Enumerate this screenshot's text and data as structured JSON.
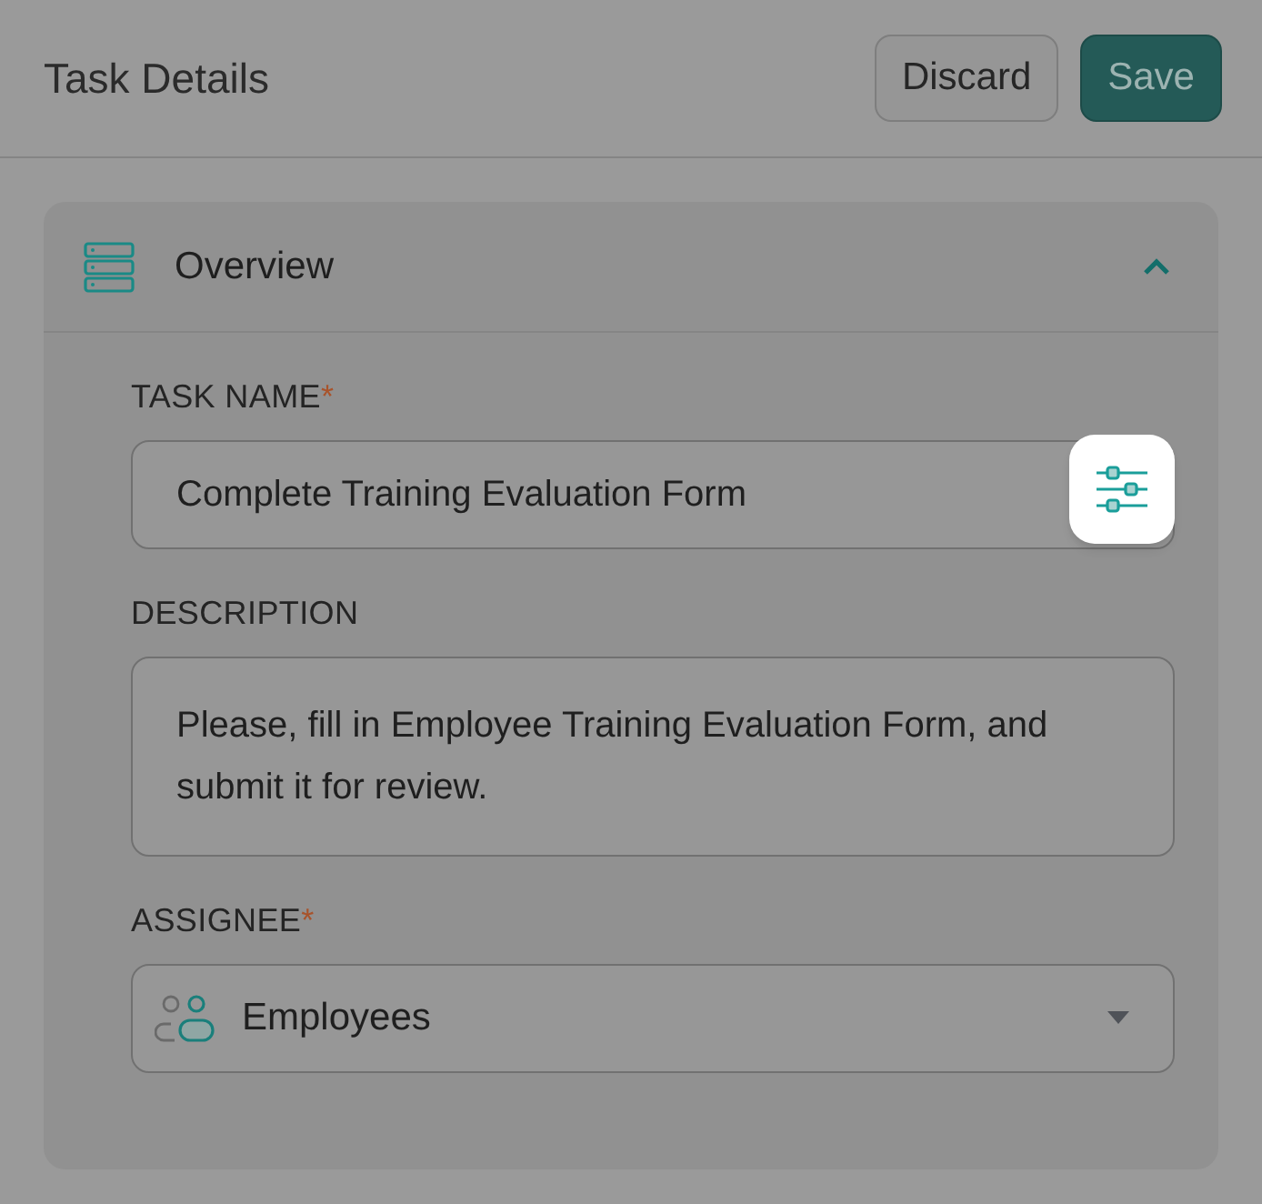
{
  "header": {
    "title": "Task Details",
    "buttons": [
      {
        "label": "Discard",
        "kind": "secondary"
      },
      {
        "label": "Save",
        "kind": "primary"
      }
    ]
  },
  "section": {
    "title": "Overview",
    "expanded": true,
    "fields": [
      {
        "kind": "text",
        "label": "TASK NAME",
        "required_mark": "*",
        "value": "Complete Training Evaluation Form",
        "settings_highlighted": true
      },
      {
        "kind": "textarea",
        "label": "DESCRIPTION",
        "value": "Please, fill in Employee Training Evaluation Form, and submit it for review."
      },
      {
        "kind": "select",
        "label": "ASSIGNEE",
        "required_mark": "*",
        "value": "Employees"
      }
    ]
  }
}
